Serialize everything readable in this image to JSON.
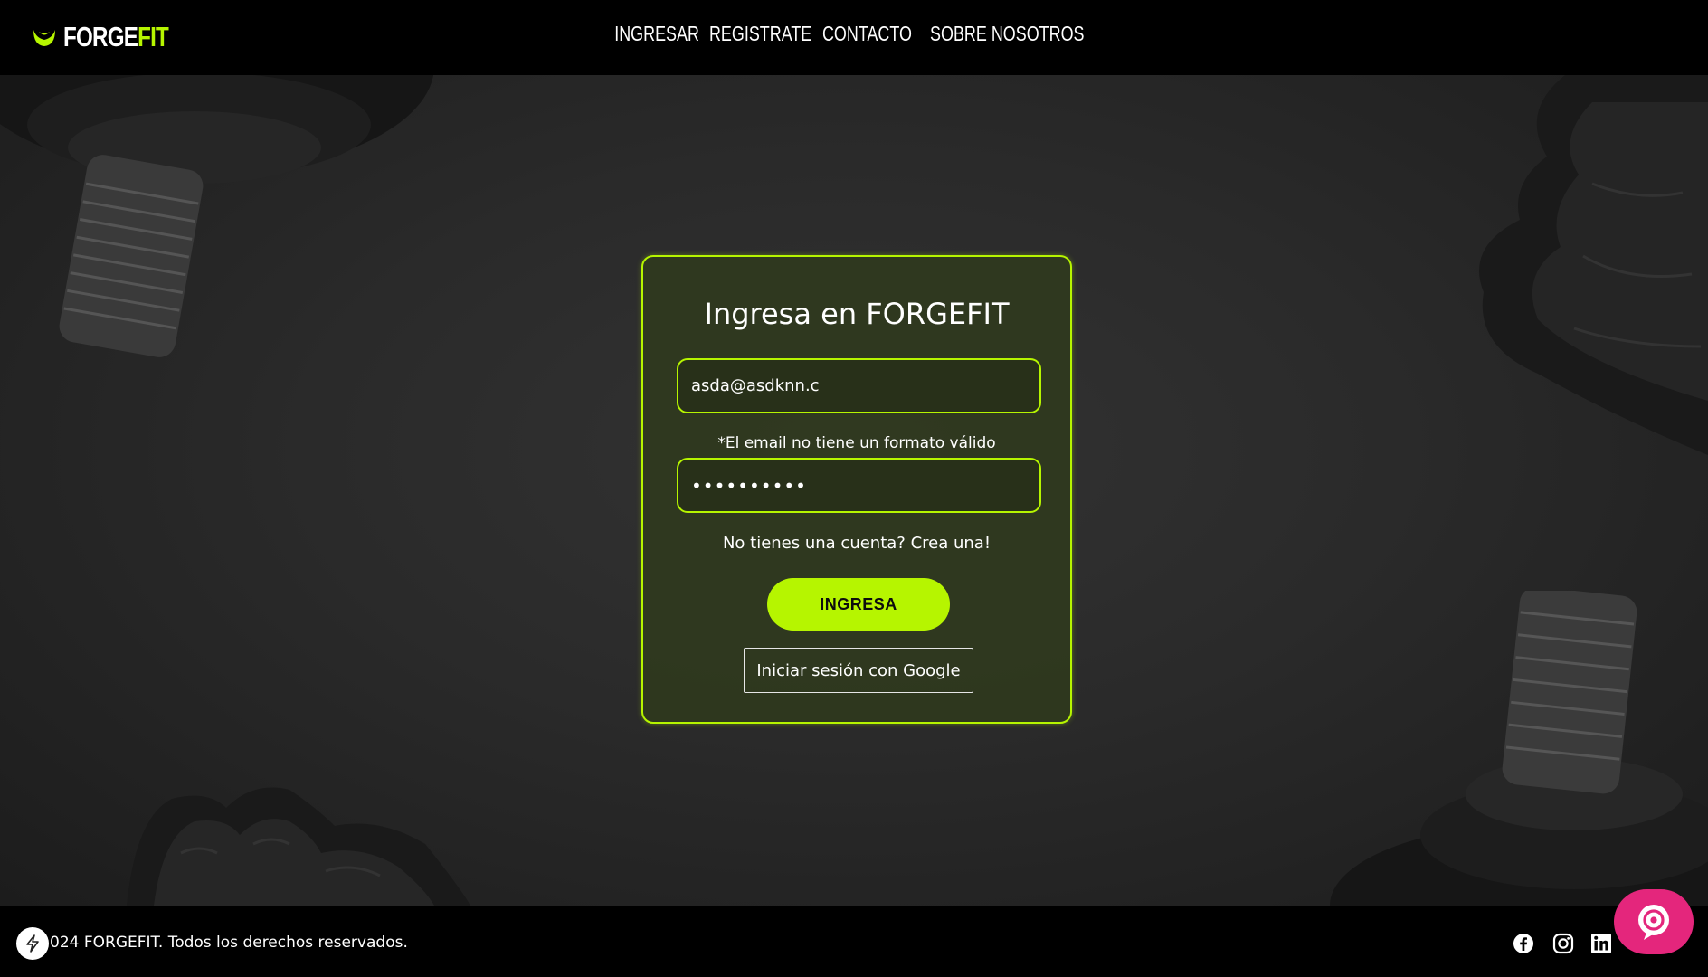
{
  "brand": {
    "part1": "FORGE",
    "part2": "FIT",
    "accent_color": "#b6f500"
  },
  "nav": [
    "INGRESAR",
    "REGISTRATE",
    "CONTACTO",
    "SOBRE NOSOTROS"
  ],
  "login": {
    "title": "Ingresa en FORGEFIT",
    "email_value": "asda@asdknn.c",
    "email_error": "*El email no tiene un formato válido",
    "password_mask": "••••••••••",
    "signup_link": "No tienes una cuenta? Crea una!",
    "submit_label": "INGRESA",
    "google_label": "Iniciar sesión con Google"
  },
  "footer": {
    "copyright": "024 FORGEFIT. Todos los derechos reservados.",
    "social_icons": [
      "facebook-icon",
      "instagram-icon",
      "linkedin-icon"
    ]
  },
  "widgets": {
    "chat_color": "#e4267c"
  }
}
